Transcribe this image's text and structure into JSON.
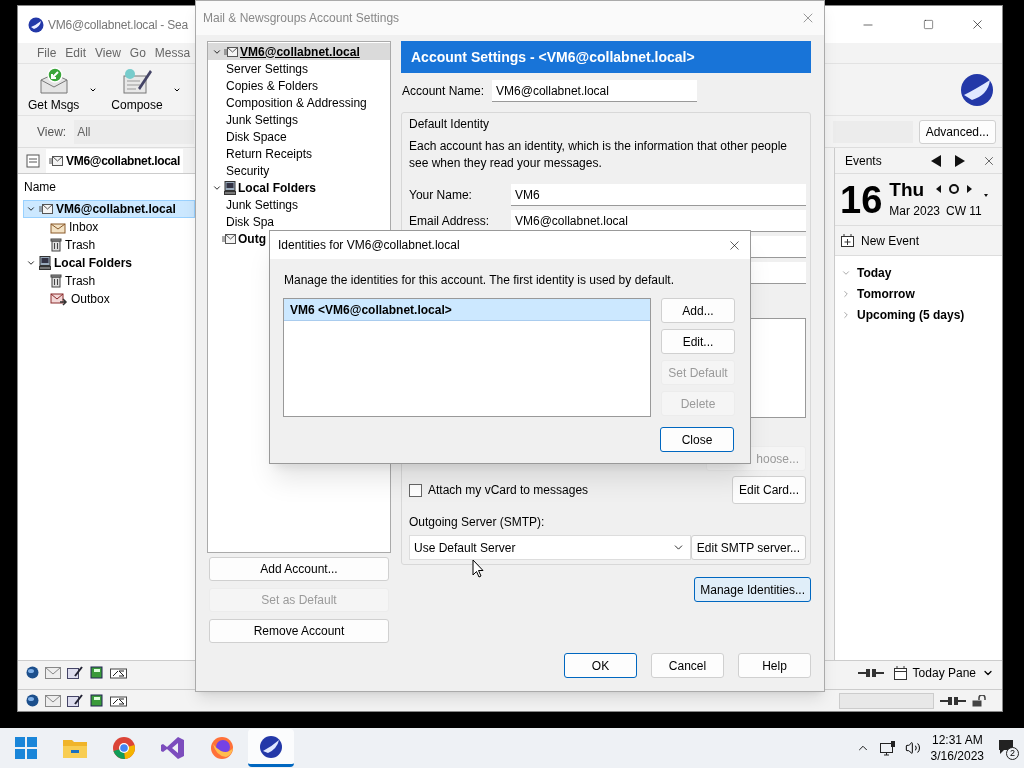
{
  "main_window": {
    "title": "VM6@collabnet.local - Sea",
    "menu": [
      "File",
      "Edit",
      "View",
      "Go",
      "Messa"
    ],
    "toolbar": [
      {
        "label": "Get Msgs",
        "kind": "get"
      },
      {
        "label": "Compose",
        "kind": "compose"
      }
    ],
    "view_label": "View:",
    "view_value": "All",
    "advanced_button": "Advanced...",
    "folder_tab": "VM6@collabnet.local",
    "column": "Name",
    "folders": [
      {
        "label": "VM6@collabnet.local",
        "kind": "account",
        "expanded": true,
        "selected": true,
        "children": [
          {
            "label": "Inbox",
            "kind": "inbox",
            "selected": false
          },
          {
            "label": "Trash",
            "kind": "trash",
            "selected": false
          }
        ]
      },
      {
        "label": "Local Folders",
        "kind": "local",
        "expanded": true,
        "selected": false,
        "children": [
          {
            "label": "Trash",
            "kind": "trash",
            "selected": false
          },
          {
            "label": "Outbox",
            "kind": "outbox",
            "selected": false
          }
        ]
      }
    ]
  },
  "events_pane": {
    "title": "Events",
    "day": "16",
    "weekday": "Thu",
    "month": "Mar 2023",
    "week": "CW 11",
    "new_event": "New Event",
    "groups": [
      {
        "label": "Today",
        "expanded": true
      },
      {
        "label": "Tomorrow",
        "expanded": false
      },
      {
        "label": "Upcoming (5 days)",
        "expanded": false
      }
    ],
    "today_pane": "Today Pane"
  },
  "account_settings": {
    "title": "Mail & Newsgroups Account Settings",
    "tree": [
      {
        "label": "VM6@collabnet.local",
        "kind": "mail",
        "expanded": true,
        "selected": true,
        "children": [
          {
            "label": "Server Settings",
            "selected": false
          },
          {
            "label": "Copies & Folders",
            "selected": false
          },
          {
            "label": "Composition & Addressing",
            "selected": false
          },
          {
            "label": "Junk Settings",
            "selected": false
          },
          {
            "label": "Disk Space",
            "selected": false
          },
          {
            "label": "Return Receipts",
            "selected": false
          },
          {
            "label": "Security",
            "selected": false
          }
        ]
      },
      {
        "label": "Local Folders",
        "kind": "local",
        "expanded": true,
        "selected": false,
        "children": [
          {
            "label": "Junk Settings",
            "selected": false
          },
          {
            "label": "Disk Spa",
            "selected": false
          }
        ]
      },
      {
        "label": "Outg",
        "kind": "mail",
        "selected": false
      }
    ],
    "header": "Account Settings - <VM6@collabnet.local>",
    "account_name_label": "Account Name:",
    "account_name": "VM6@collabnet.local",
    "identity_group": "Default Identity",
    "identity_text": "Each account has an identity, which is the information that other people see when they read your messages.",
    "fields": [
      {
        "label": "Your Name:",
        "value": "VM6"
      },
      {
        "label": "Email Address:",
        "value": "VM6@collabnet.local"
      }
    ],
    "choose_button": "hoose...",
    "vcard": {
      "label": "Attach my vCard to messages",
      "checked": false
    },
    "edit_card": "Edit Card...",
    "smtp_label": "Outgoing Server (SMTP):",
    "smtp_value": "Use Default Server",
    "edit_smtp": "Edit SMTP server...",
    "manage_identities": {
      "label": "Manage Identities...",
      "focused": true
    },
    "account_buttons": [
      {
        "label": "Add Account...",
        "disabled": false
      },
      {
        "label": "Set as Default",
        "disabled": true
      },
      {
        "label": "Remove Account",
        "disabled": false
      }
    ],
    "dialog_buttons": [
      {
        "label": "OK",
        "default": true
      },
      {
        "label": "Cancel",
        "default": false
      },
      {
        "label": "Help",
        "default": false
      }
    ]
  },
  "identities_dialog": {
    "title": "Identities for VM6@collabnet.local",
    "description": "Manage the identities for this account. The first identity is used by default.",
    "identities": [
      {
        "label": "VM6 <VM6@collabnet.local>",
        "selected": true
      }
    ],
    "buttons": [
      {
        "label": "Add...",
        "disabled": false
      },
      {
        "label": "Edit...",
        "disabled": false
      },
      {
        "label": "Set Default",
        "disabled": true
      },
      {
        "label": "Delete",
        "disabled": true
      }
    ],
    "close_button": {
      "label": "Close",
      "default": true
    }
  },
  "taskbar": {
    "apps": [
      {
        "kind": "start",
        "active": false
      },
      {
        "kind": "files",
        "active": false
      },
      {
        "kind": "chrome",
        "active": false
      },
      {
        "kind": "studio",
        "active": false
      },
      {
        "kind": "firefox",
        "active": false
      },
      {
        "kind": "seamonkey",
        "active": true
      }
    ],
    "time": "12:31 AM",
    "date": "3/16/2023",
    "notifications": "2"
  }
}
